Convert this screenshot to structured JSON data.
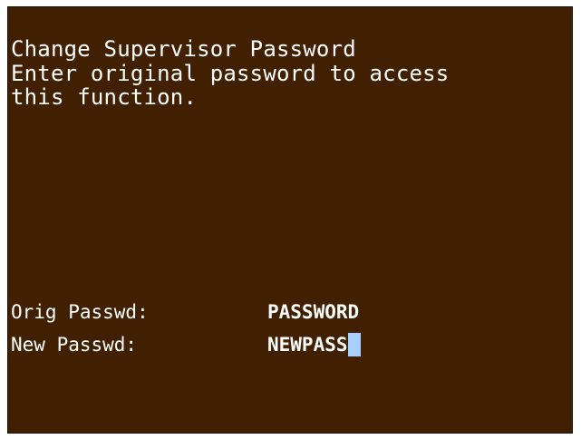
{
  "screen": {
    "background_color": "#402000",
    "text_color": "#ffffff",
    "cursor_color": "#a8d0ff"
  },
  "header": {
    "line1": "Change Supervisor Password",
    "line2": "Enter original password to access",
    "line3": "this function."
  },
  "fields": {
    "original": {
      "label": "Orig Passwd:",
      "value": "PASSWORD"
    },
    "new": {
      "label": "New Passwd:",
      "value": "NEWPASS"
    }
  }
}
